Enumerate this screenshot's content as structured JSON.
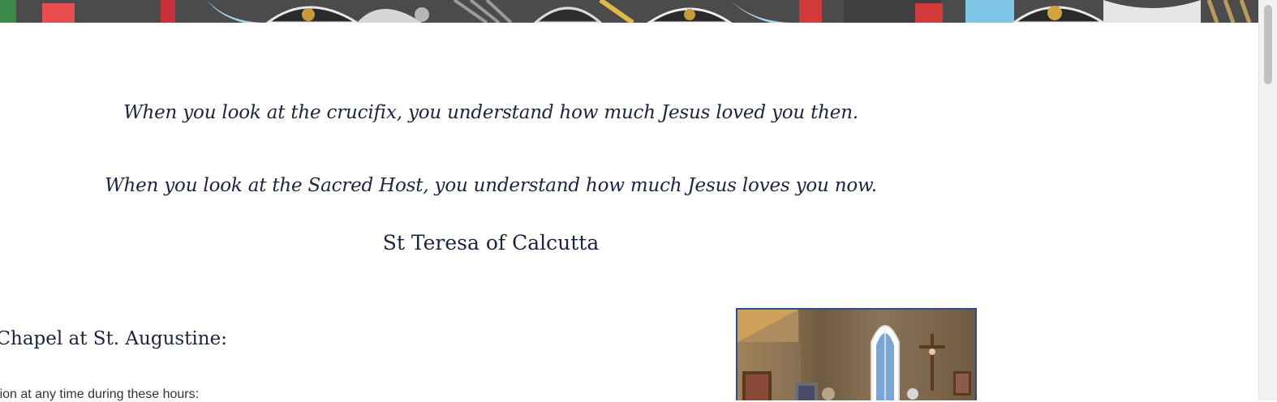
{
  "banner": {
    "image": "stained-glass-window"
  },
  "quote": {
    "line1": "When you look at the crucifix, you understand how much Jesus loved you then.",
    "line2": "When you look at the Sacred Host, you understand how much Jesus loves you now.",
    "attribution": "St Teresa of Calcutta"
  },
  "chapel": {
    "heading": "y’s Chapel at St. Augustine:",
    "intro_text": "oration at any time during these hours:",
    "photo": "chapel-interior-photo"
  },
  "colors": {
    "text": "#1b2440",
    "photo_border": "#2c4f8c"
  }
}
